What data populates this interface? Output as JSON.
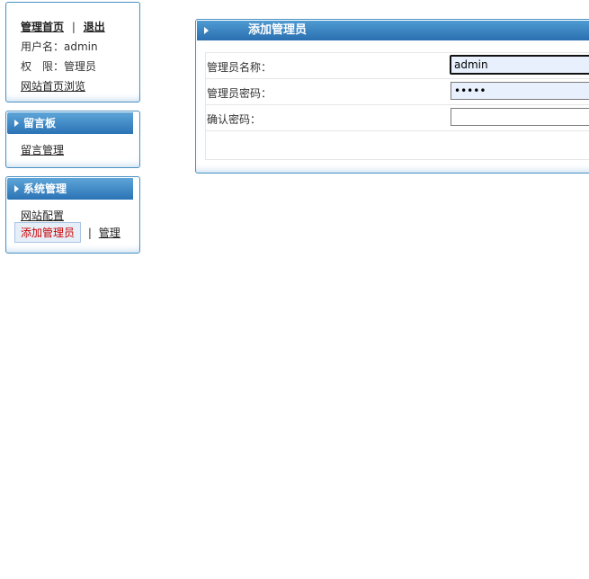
{
  "box1": {
    "home_link": "管理首页",
    "separator": "|",
    "logout_link": "退出",
    "username_line": "用户名：admin",
    "role_line": "权　限：管理员",
    "browse_link": "网站首页浏览"
  },
  "box2": {
    "title": "留言板",
    "items": [
      "留言管理"
    ]
  },
  "box3": {
    "title": "系统管理",
    "site_config": "网站配置",
    "add_admin": "添加管理员",
    "separator": "|",
    "manage": "管理"
  },
  "form": {
    "title": "添加管理员",
    "fields": [
      {
        "label": "管理员名称：",
        "value": "admin"
      },
      {
        "label": "管理员密码：",
        "value": "•••••"
      },
      {
        "label": "确认密码：",
        "value": ""
      }
    ]
  },
  "colors": {
    "header_top": "#5da5d8",
    "header_bottom": "#2a73b5",
    "border": "#4a90c2",
    "active_link": "#cc0000"
  }
}
